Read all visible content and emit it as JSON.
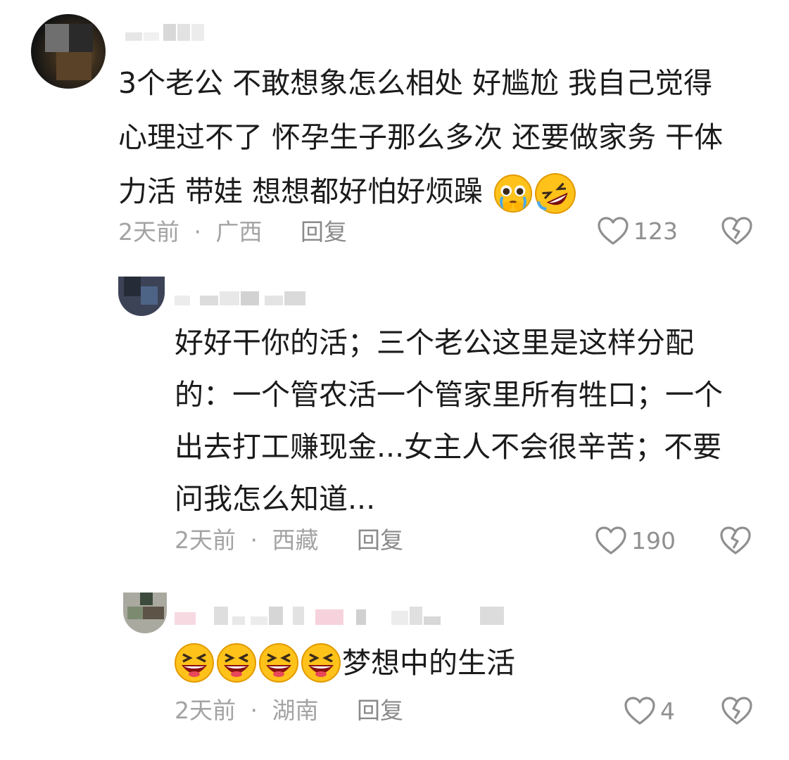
{
  "comments": [
    {
      "text": "3个老公  不敢想象怎么相处  好尴尬  我自己觉得\n心理过不了  怀孕生子那么多次  还要做家务  干体\n力活  带娃  想想都好怕好烦躁",
      "emojis": [
        "pleading-crying-face",
        "rolling-laughing-face"
      ],
      "time": "2天前",
      "separator": "·",
      "location": "广西",
      "reply_label": "回复",
      "likes": "123"
    },
    {
      "text": "好好干你的活；三个老公这里是这样分配\n的：一个管农活一个管家里所有牲口；一个\n出去打工赚现金...女主人不会很辛苦；不要\n问我怎么知道...",
      "time": "2天前",
      "separator": "·",
      "location": "西藏",
      "reply_label": "回复",
      "likes": "190"
    },
    {
      "text": "梦想中的生活",
      "emojis": [
        "grinning-squinting-face",
        "grinning-squinting-face",
        "grinning-squinting-face",
        "grinning-squinting-face"
      ],
      "time": "2天前",
      "separator": "·",
      "location": "湖南",
      "reply_label": "回复",
      "likes": "4"
    }
  ],
  "icons": {
    "like": "heart-outline-icon",
    "dislike": "broken-heart-icon"
  },
  "colors": {
    "text": "#1b1b1b",
    "meta": "#a3a3a3",
    "icon": "#8f8f8f",
    "emoji_face": "#ffc21a"
  }
}
